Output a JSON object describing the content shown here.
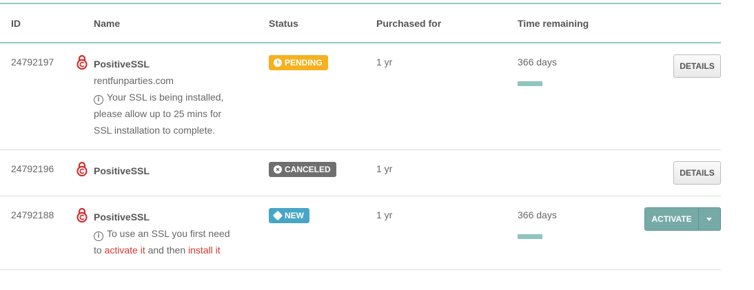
{
  "columns": {
    "id": "ID",
    "name": "Name",
    "status": "Status",
    "purchased_for": "Purchased for",
    "time_remaining": "Time remaining"
  },
  "rows": [
    {
      "id": "24792197",
      "product": "PositiveSSL",
      "domain": "rentfunparties.com",
      "note_lines": [
        "Your SSL is being installed,",
        "please allow up to 25 mins for",
        "SSL installation to complete."
      ],
      "status": "PENDING",
      "purchased_for": "1 yr",
      "time_remaining": "366 days",
      "button": "DETAILS"
    },
    {
      "id": "24792196",
      "product": "PositiveSSL",
      "status": "CANCELED",
      "purchased_for": "1 yr",
      "button": "DETAILS"
    },
    {
      "id": "24792188",
      "product": "PositiveSSL",
      "note_line1": "To use an SSL you first need",
      "note_line2_pre": "to ",
      "note_link1": "activate it",
      "note_line2_mid": " and then ",
      "note_link2": "install it",
      "status": "NEW",
      "purchased_for": "1 yr",
      "time_remaining": "366 days",
      "button": "ACTIVATE"
    }
  ],
  "colors": {
    "accent_teal": "#8fc7bf",
    "pending": "#f5b120",
    "canceled": "#6f6f6f",
    "new": "#47a5c7",
    "link_red": "#d33a2c",
    "ssl_icon": "#d32f2f"
  },
  "icons": {
    "ssl": "lock-ssl-icon",
    "info": "info-icon",
    "pending": "clock-icon",
    "canceled": "x-circle-icon",
    "new": "cube-icon",
    "dropdown": "caret-down-icon"
  }
}
